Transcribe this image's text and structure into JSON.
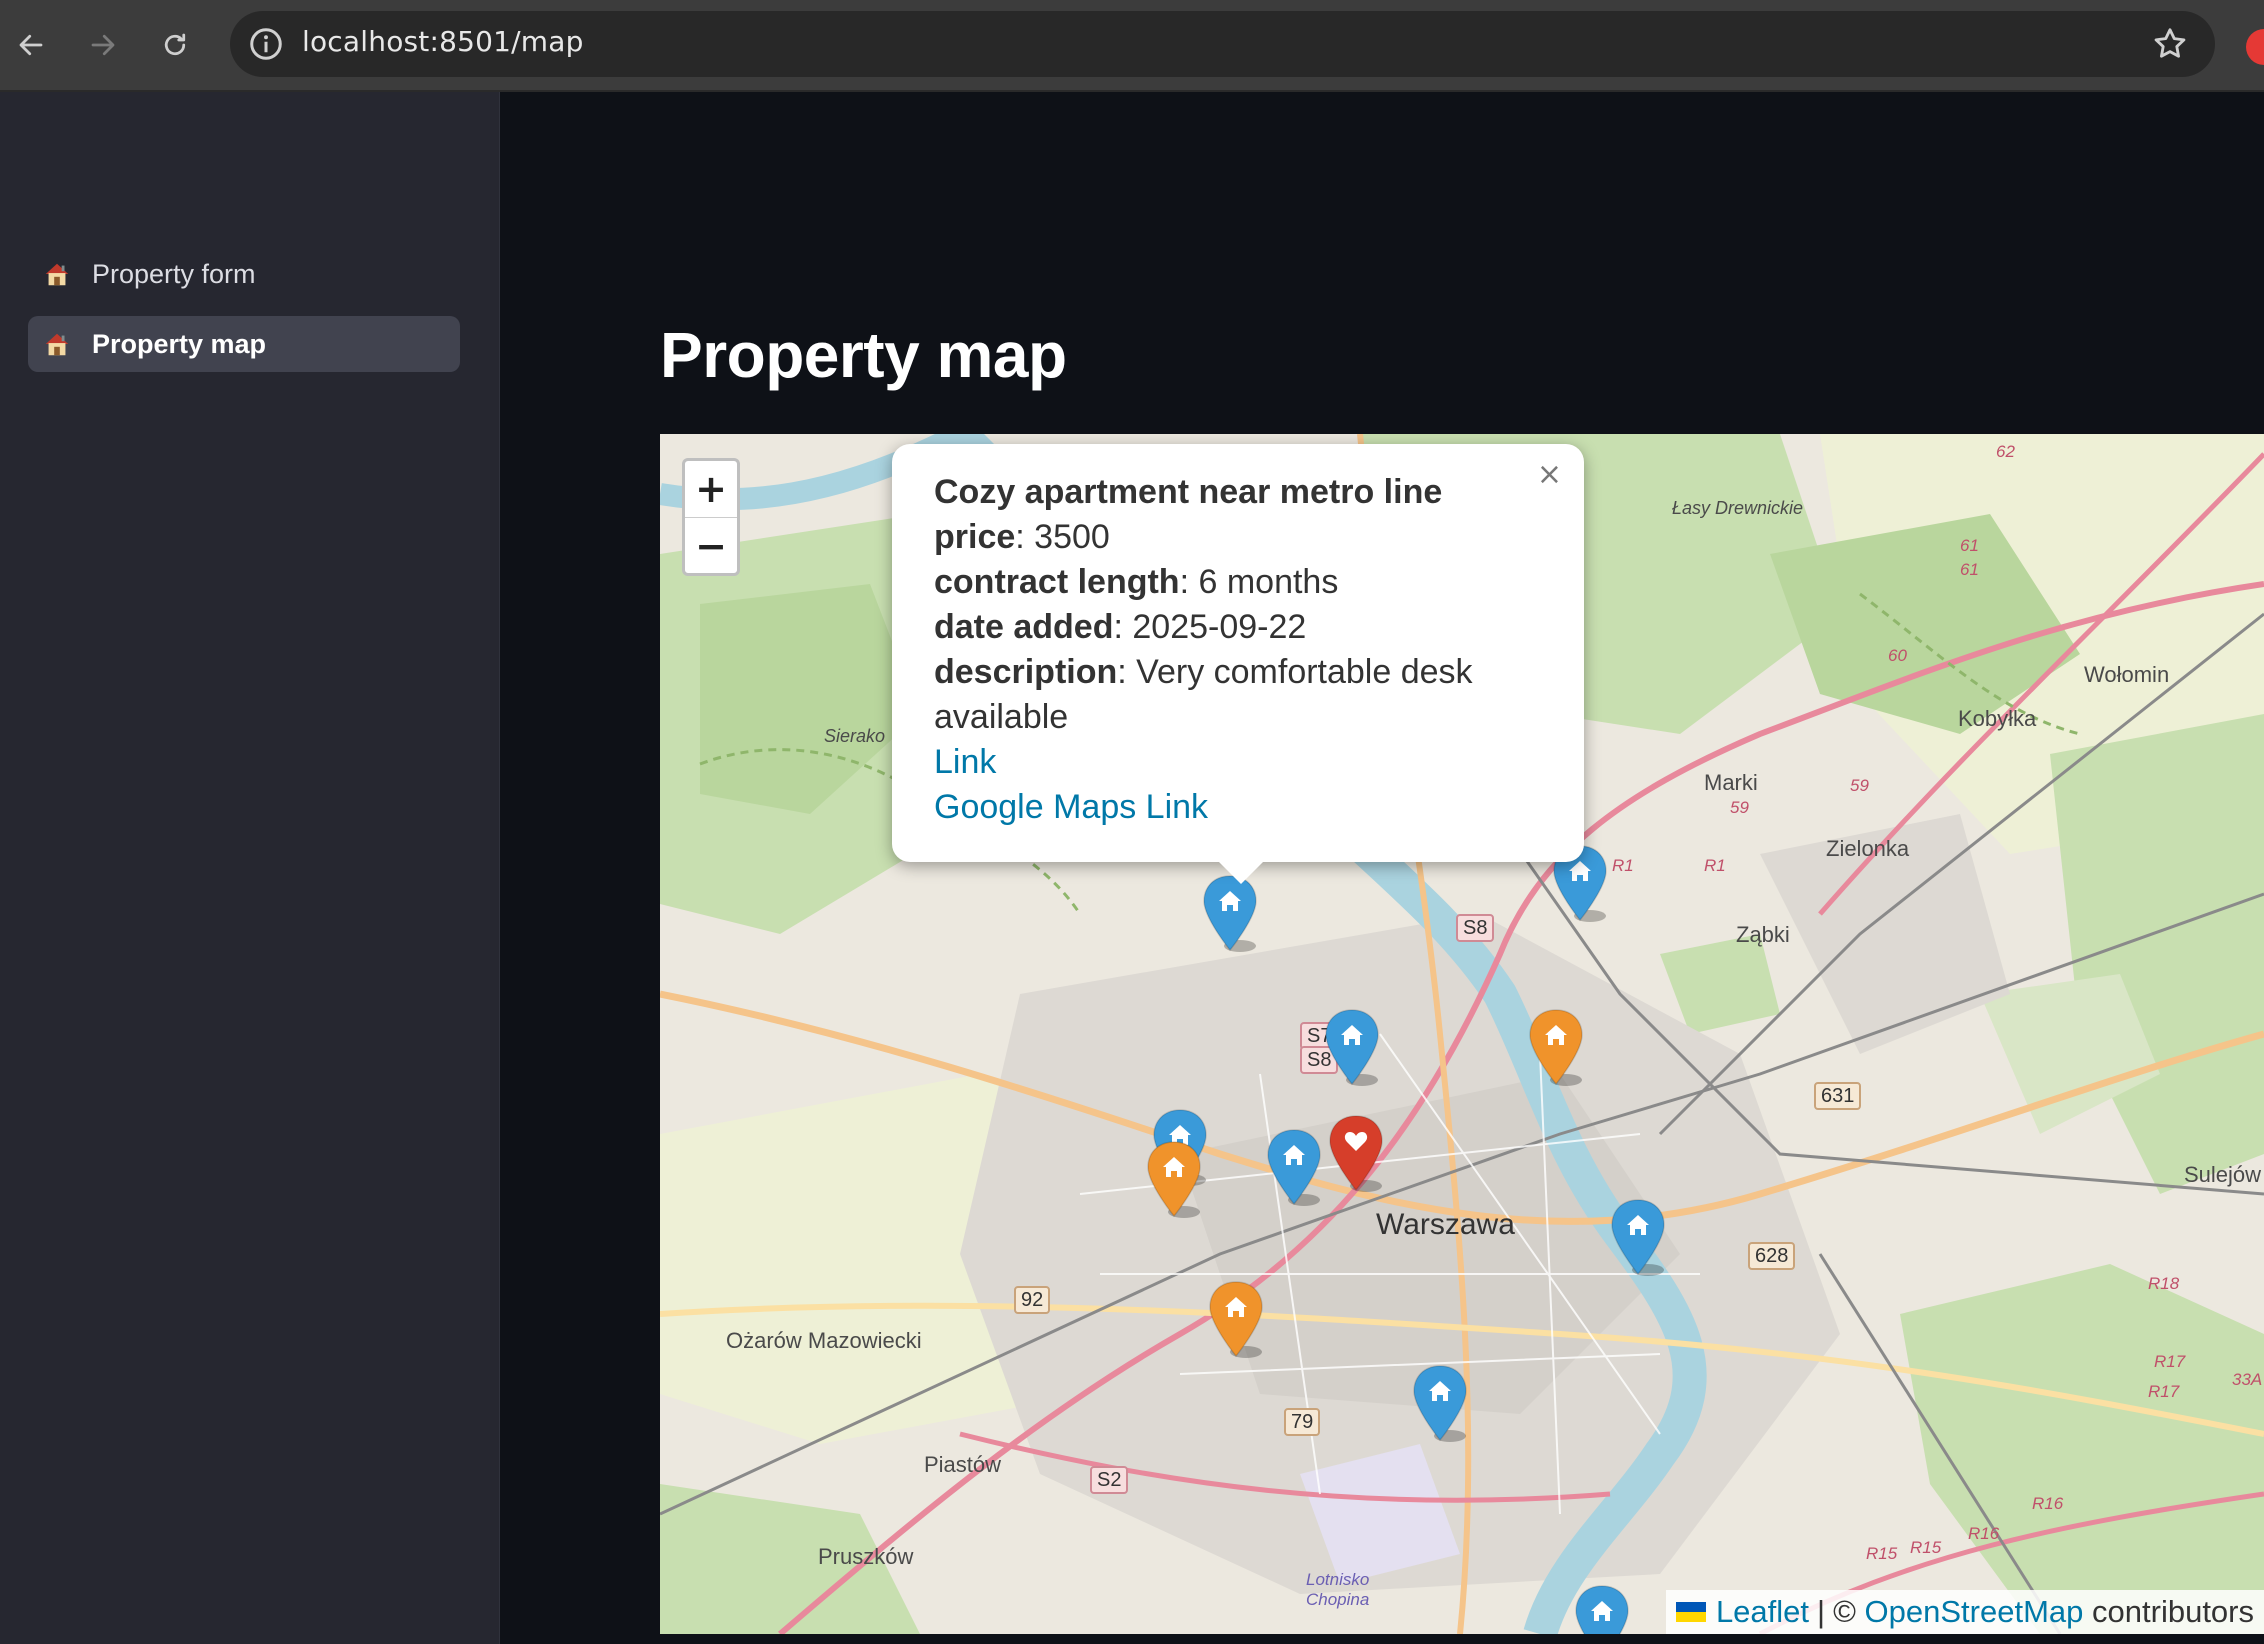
{
  "browser": {
    "url": "localhost:8501/map",
    "back_icon": "arrow-left-icon",
    "forward_icon": "arrow-right-icon",
    "reload_icon": "reload-icon",
    "info_icon": "info-icon",
    "bookmark_icon": "star-icon"
  },
  "sidebar": {
    "items": [
      {
        "label": "Property form",
        "icon": "house-icon",
        "active": false
      },
      {
        "label": "Property map",
        "icon": "house-icon",
        "active": true
      }
    ]
  },
  "main": {
    "title": "Property map"
  },
  "map": {
    "zoom_in": "+",
    "zoom_out": "−",
    "popup": {
      "title": "Cozy apartment near metro line",
      "fields": [
        {
          "key": "price",
          "value": "3500"
        },
        {
          "key": "contract length",
          "value": "6 months"
        },
        {
          "key": "date added",
          "value": "2025-09-22"
        },
        {
          "key": "description",
          "value": "Very comfortable desk available"
        }
      ],
      "link_label": "Link",
      "gmaps_label": "Google Maps Link",
      "close": "×"
    },
    "attribution": {
      "leaflet": "Leaflet",
      "separator": "|",
      "copyright": "©",
      "osm": "OpenStreetMap",
      "contributors": "contributors"
    },
    "place_labels": [
      "Łasy Drewnickie",
      "Wołomin",
      "Kobyłka",
      "Marki",
      "Zielonka",
      "Ząbki",
      "Sulejów",
      "Warszawa",
      "Ożarów Mazowiecki",
      "Piastów",
      "Pruszków",
      "Lotnisko Chopina",
      "Sierako"
    ],
    "road_labels": [
      "S8",
      "S7",
      "S8",
      "631",
      "628",
      "92",
      "79",
      "S2",
      "R1",
      "R1",
      "R18",
      "R17",
      "R17",
      "R16",
      "R15",
      "R15",
      "R16",
      "59",
      "59",
      "60",
      "61",
      "61",
      "62",
      "33A"
    ],
    "markers": [
      {
        "color": "#3a9ad9",
        "icon": "house-icon"
      },
      {
        "color": "#3a9ad9",
        "icon": "house-icon"
      },
      {
        "color": "#3a9ad9",
        "icon": "house-icon"
      },
      {
        "color": "#f0932b",
        "icon": "house-icon"
      },
      {
        "color": "#3a9ad9",
        "icon": "house-icon"
      },
      {
        "color": "#f0932b",
        "icon": "house-icon"
      },
      {
        "color": "#3a9ad9",
        "icon": "house-icon"
      },
      {
        "color": "#d63e2a",
        "icon": "heart-icon"
      },
      {
        "color": "#3a9ad9",
        "icon": "house-icon"
      },
      {
        "color": "#f0932b",
        "icon": "house-icon"
      },
      {
        "color": "#3a9ad9",
        "icon": "house-icon"
      },
      {
        "color": "#3a9ad9",
        "icon": "house-icon"
      }
    ]
  }
}
